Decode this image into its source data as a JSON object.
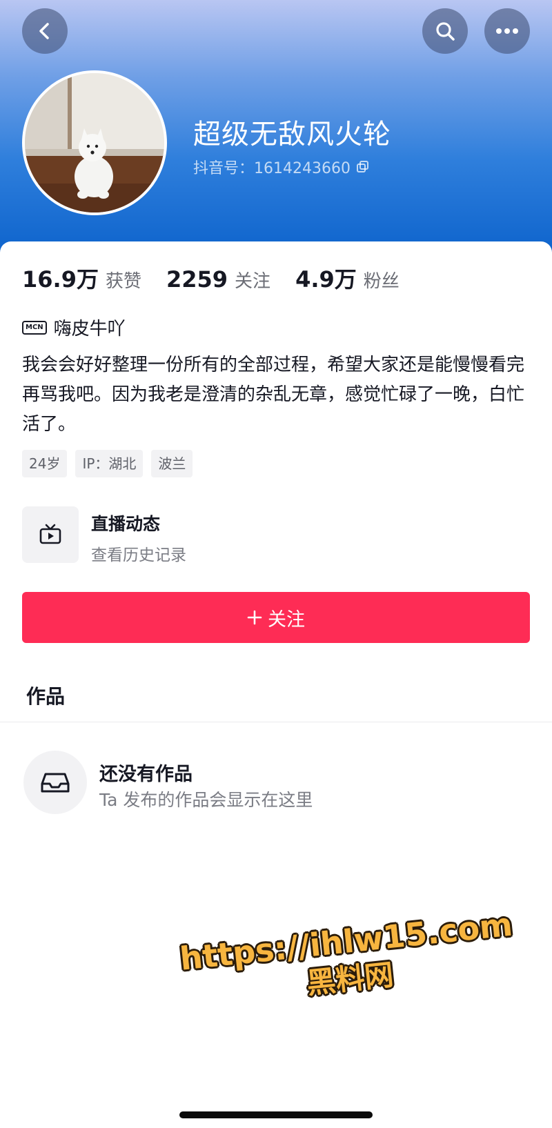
{
  "header": {
    "name": "超级无敌风火轮",
    "douyin_id": "抖音号：1614243660",
    "icons": {
      "back": "chevron-left-icon",
      "search": "search-icon",
      "more": "more-dots-icon",
      "copy": "copy-icon"
    }
  },
  "stats": [
    {
      "value": "16.9万",
      "label": "获赞"
    },
    {
      "value": "2259",
      "label": "关注"
    },
    {
      "value": "4.9万",
      "label": "粉丝"
    }
  ],
  "mcn": {
    "badge": "MCN",
    "name": "嗨皮牛吖"
  },
  "bio": "我会会好好整理一份所有的全部过程，希望大家还是能慢慢看完再骂我吧。因为我老是澄清的杂乱无章，感觉忙碌了一晚，白忙活了。",
  "tags": [
    "24岁",
    "IP：湖北",
    "波兰"
  ],
  "live": {
    "title": "直播动态",
    "subtitle": "查看历史记录",
    "icon": "tv-icon"
  },
  "follow_button": {
    "label": "关注",
    "icon": "plus-icon"
  },
  "works": {
    "section_title": "作品",
    "empty_title": "还没有作品",
    "empty_subtitle": "Ta 发布的作品会显示在这里",
    "icon": "inbox-icon"
  },
  "watermark": {
    "line1": "https://ihlw15.com",
    "line2": "黑料网"
  },
  "colors": {
    "accent": "#fe2c55",
    "header_top": "#b9c6f2",
    "header_bottom": "#0d63cc",
    "watermark": "#f7b53f"
  }
}
